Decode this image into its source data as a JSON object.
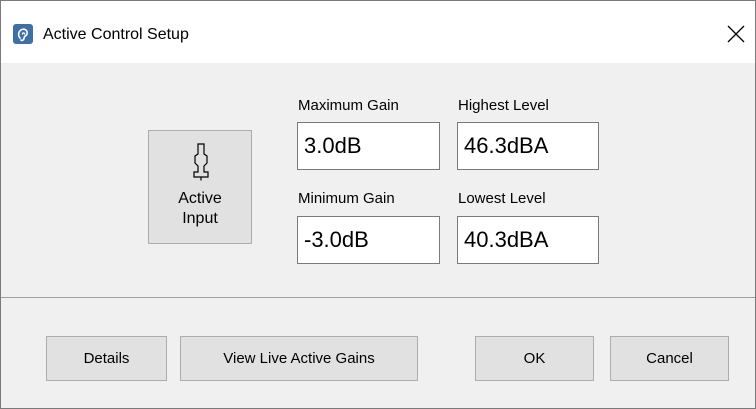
{
  "window": {
    "title": "Active Control Setup",
    "icon": "ear-app-icon",
    "close_icon": "close-icon"
  },
  "active_input": {
    "icon": "plug-icon",
    "label": "Active\nInput"
  },
  "fields": {
    "maximum_gain": {
      "label": "Maximum Gain",
      "value": "3.0dB"
    },
    "highest_level": {
      "label": "Highest Level",
      "value": "46.3dBA"
    },
    "minimum_gain": {
      "label": "Minimum Gain",
      "value": "-3.0dB"
    },
    "lowest_level": {
      "label": "Lowest Level",
      "value": "40.3dBA"
    }
  },
  "buttons": {
    "details": "Details",
    "view_live_active_gains": "View Live Active Gains",
    "ok": "OK",
    "cancel": "Cancel"
  },
  "colors": {
    "title_bar": "#ffffff",
    "dialog_background": "#f0f0f0",
    "button_face": "#e1e1e1",
    "button_border": "#adadad",
    "app_icon": "#3f6fa3"
  }
}
